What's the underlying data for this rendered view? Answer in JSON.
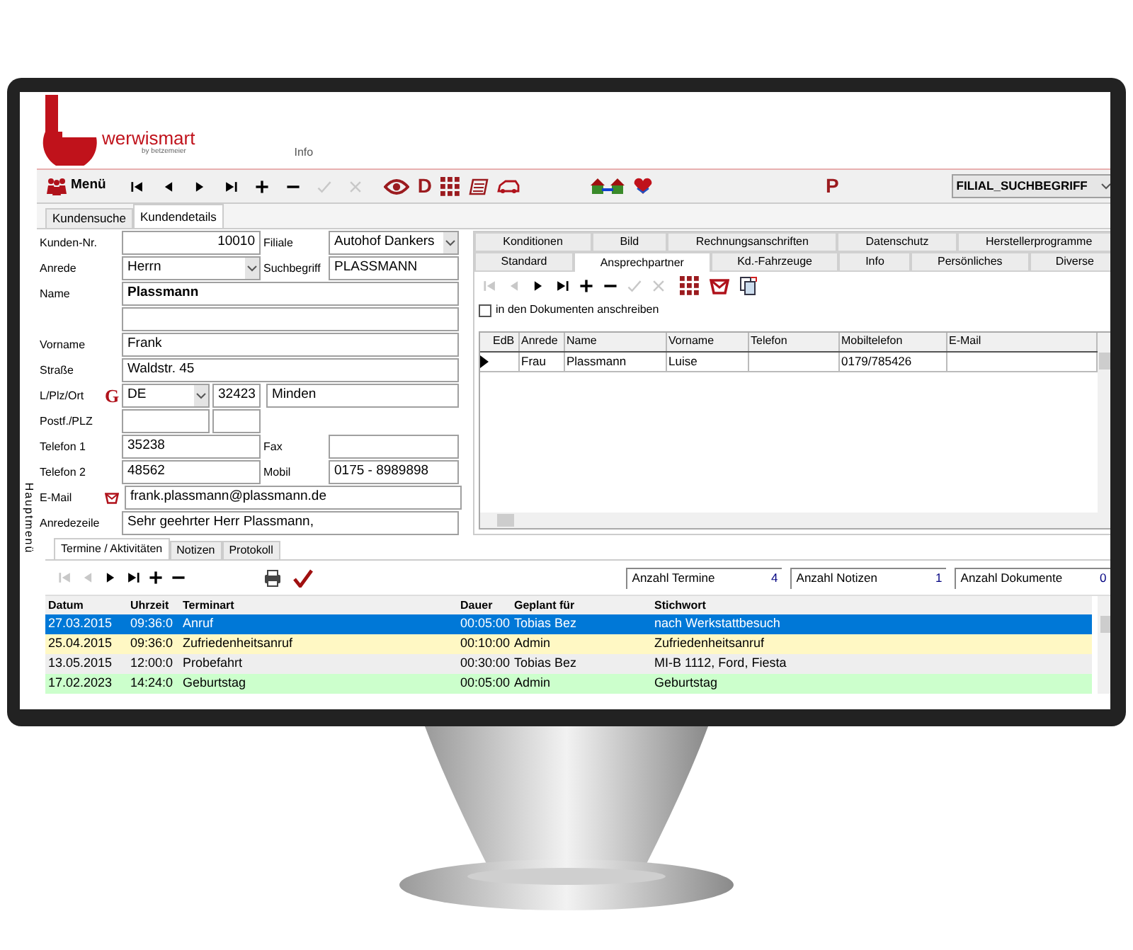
{
  "logo": {
    "brand": "werwismart",
    "tagline": "by betzemeier"
  },
  "header_link": "Info",
  "toolbar": {
    "menu_label": "Menü",
    "nav_buttons": [
      {
        "kind": "first",
        "disabled": false
      },
      {
        "kind": "prev",
        "disabled": false
      },
      {
        "kind": "next",
        "disabled": false
      },
      {
        "kind": "last",
        "disabled": false
      },
      {
        "kind": "add",
        "disabled": false
      },
      {
        "kind": "remove",
        "disabled": false
      },
      {
        "kind": "confirm",
        "disabled": true
      },
      {
        "kind": "cancel",
        "disabled": true
      }
    ],
    "d_label": "D",
    "p_label": "P",
    "search_mode": "FILIAL_SUCHBEGRIFF"
  },
  "main_tabs": [
    {
      "label": "Kundensuche",
      "selected": false
    },
    {
      "label": "Kundendetails",
      "selected": true
    }
  ],
  "side_label": "Hauptmenü",
  "customer": {
    "kunden_nr": {
      "label": "Kunden-Nr.",
      "value": "10010"
    },
    "filiale": {
      "label": "Filiale",
      "value": "Autohof Dankers"
    },
    "anrede": {
      "label": "Anrede",
      "value": "Herrn"
    },
    "suchbegriff": {
      "label": "Suchbegriff",
      "value": "PLASSMANN"
    },
    "name": {
      "label": "Name",
      "value": "Plassmann"
    },
    "vorname": {
      "label": "Vorname",
      "value": "Frank"
    },
    "strasse": {
      "label": "Straße",
      "value": "Waldstr. 45"
    },
    "ort": {
      "label": "L/Plz/Ort",
      "marker": "G",
      "country": "DE",
      "zip": "32423",
      "city": "Minden"
    },
    "postfach": {
      "label": "Postf./PLZ"
    },
    "telefon1": {
      "label": "Telefon 1",
      "value": "35238"
    },
    "fax": {
      "label": "Fax"
    },
    "telefon2": {
      "label": "Telefon 2",
      "value": "48562"
    },
    "mobil": {
      "label": "Mobil",
      "value": "0175 - 8989898"
    },
    "email": {
      "label": "E-Mail",
      "value": "frank.plassmann@plassmann.de"
    },
    "anredezeile": {
      "label": "Anredezeile",
      "value": "Sehr geehrter Herr Plassmann,"
    }
  },
  "detail_tabs": [
    [
      {
        "label": "Konditionen",
        "selected": false
      },
      {
        "label": "Bild",
        "selected": false
      },
      {
        "label": "Rechnungsanschriften",
        "selected": false
      },
      {
        "label": "Datenschutz",
        "selected": false
      },
      {
        "label": "Herstellerprogramme",
        "selected": false
      }
    ],
    [
      {
        "label": "Standard",
        "selected": false
      },
      {
        "label": "Ansprechpartner",
        "selected": true
      },
      {
        "label": "Kd.-Fahrzeuge",
        "selected": false
      },
      {
        "label": "Info",
        "selected": false
      },
      {
        "label": "Persönliches",
        "selected": false
      },
      {
        "label": "Diverse",
        "selected": false
      }
    ]
  ],
  "contacts": {
    "nav_buttons": [
      {
        "kind": "first",
        "disabled": true
      },
      {
        "kind": "prev",
        "disabled": true
      },
      {
        "kind": "next",
        "disabled": false
      },
      {
        "kind": "last",
        "disabled": false
      },
      {
        "kind": "add",
        "disabled": false
      },
      {
        "kind": "remove",
        "disabled": false
      },
      {
        "kind": "confirm",
        "disabled": true
      },
      {
        "kind": "cancel",
        "disabled": true
      }
    ],
    "checkbox": {
      "label": "in den Dokumenten anschreiben",
      "checked": false
    },
    "columns": [
      "EdB",
      "Anrede",
      "Name",
      "Vorname",
      "Telefon",
      "Mobiltelefon",
      "E-Mail"
    ],
    "rows": [
      {
        "current": true,
        "anrede": "Frau",
        "name": "Plassmann",
        "vorname": "Luise",
        "mobiltelefon": "0179/785426"
      }
    ]
  },
  "activity_tabs": [
    {
      "label": "Termine / Aktivitäten",
      "selected": true
    },
    {
      "label": "Notizen",
      "selected": false
    },
    {
      "label": "Protokoll",
      "selected": false
    }
  ],
  "activity_nav": [
    {
      "kind": "first",
      "disabled": true
    },
    {
      "kind": "prev",
      "disabled": true
    },
    {
      "kind": "next",
      "disabled": false
    },
    {
      "kind": "last",
      "disabled": false
    },
    {
      "kind": "add",
      "disabled": false
    },
    {
      "kind": "remove",
      "disabled": false
    }
  ],
  "counters": [
    {
      "label": "Anzahl Termine",
      "value": "4"
    },
    {
      "label": "Anzahl Notizen",
      "value": "1"
    },
    {
      "label": "Anzahl Dokumente",
      "value": "0"
    }
  ],
  "appointments": {
    "columns": [
      "Datum",
      "Uhrzeit",
      "Terminart",
      "Dauer",
      "Geplant für",
      "Stichwort"
    ],
    "rows": [
      {
        "selected": true,
        "color": "#0078d7",
        "cells": [
          "27.03.2015",
          "09:36:0",
          "Anruf",
          "00:05:00",
          "Tobias Bez",
          "nach Werkstattbesuch"
        ]
      },
      {
        "selected": false,
        "color": "#fff8c4",
        "cells": [
          "25.04.2015",
          "09:36:0",
          "Zufriedenheitsanruf",
          "00:10:00",
          "Admin",
          "Zufriedenheitsanruf"
        ]
      },
      {
        "selected": false,
        "color": "#eeeeee",
        "cells": [
          "13.05.2015",
          "12:00:0",
          "Probefahrt",
          "00:30:00",
          "Tobias Bez",
          "MI-B 1112, Ford, Fiesta"
        ]
      },
      {
        "selected": false,
        "color": "#ccffcc",
        "cells": [
          "17.02.2023",
          "14:24:0",
          "Geburtstag",
          "00:05:00",
          "Admin",
          "Geburtstag"
        ]
      }
    ]
  }
}
